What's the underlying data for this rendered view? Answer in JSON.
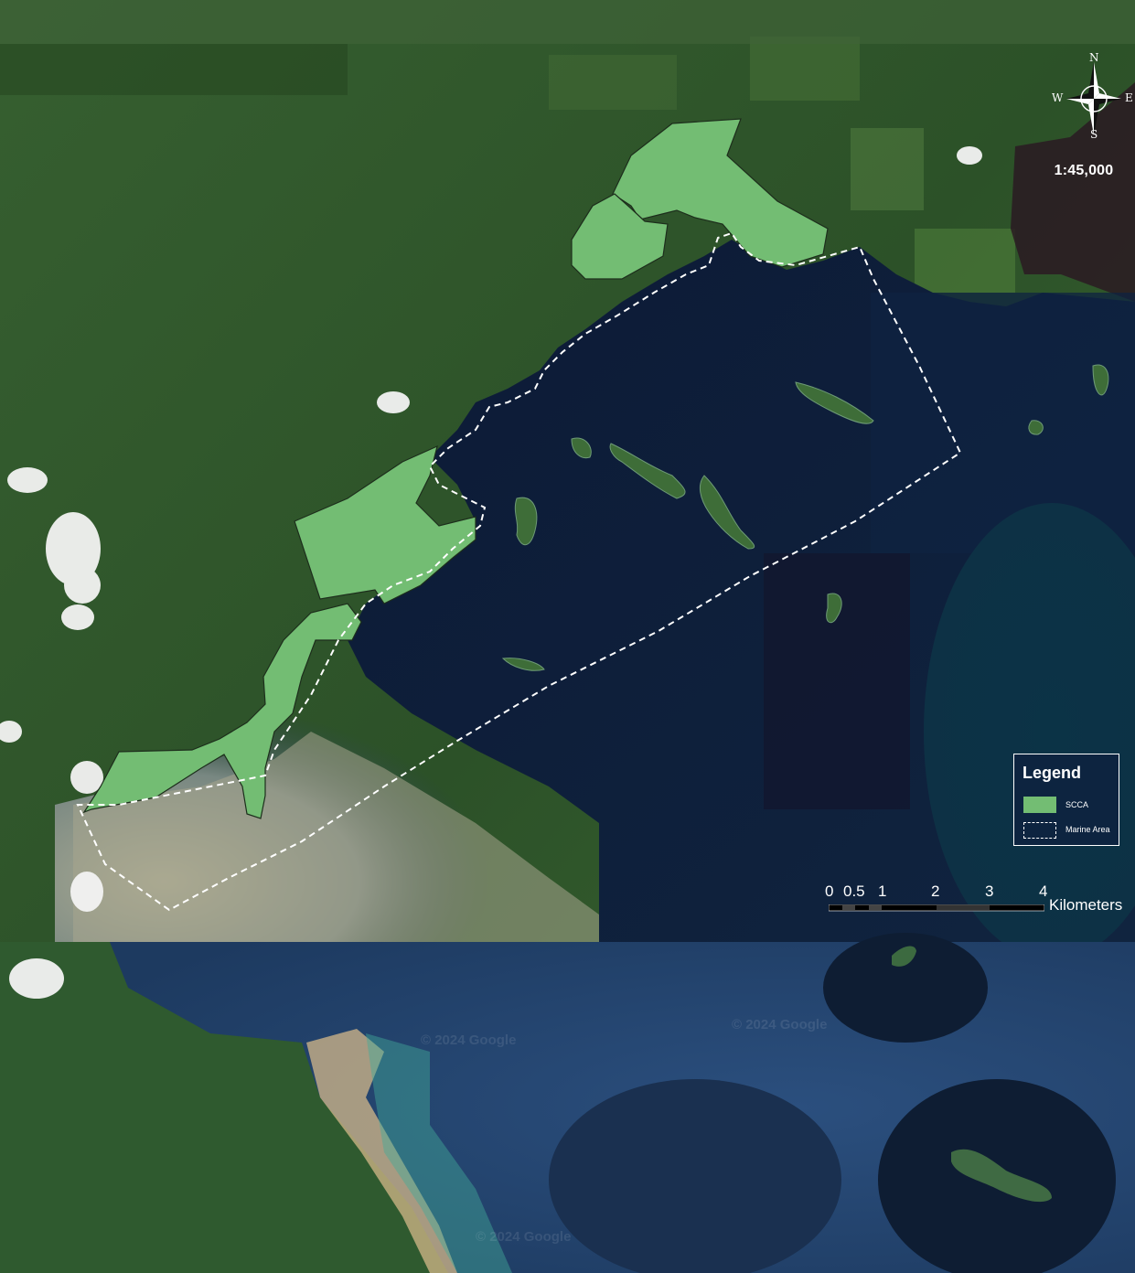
{
  "map": {
    "compass": {
      "n": "N",
      "s": "S",
      "e": "E",
      "w": "W"
    },
    "scale_ratio": "1:45,000",
    "legend": {
      "title": "Legend",
      "items": [
        {
          "label": "SCCA",
          "swatch": "green-fill"
        },
        {
          "label": "Marine Area",
          "swatch": "dashed-outline"
        }
      ]
    },
    "scale_bar": {
      "ticks": [
        "0",
        "0.5",
        "1",
        "2",
        "3",
        "4"
      ],
      "unit": "Kilometers"
    },
    "attributions": [
      "© 2024 Google",
      "© 2024 Google",
      "© 2024 Google"
    ],
    "colors": {
      "scca_fill": "#73bd73",
      "land_forest": "#2f5a2c",
      "sea_deep": "#0f2040",
      "legend_bg": "#0d2440"
    }
  }
}
